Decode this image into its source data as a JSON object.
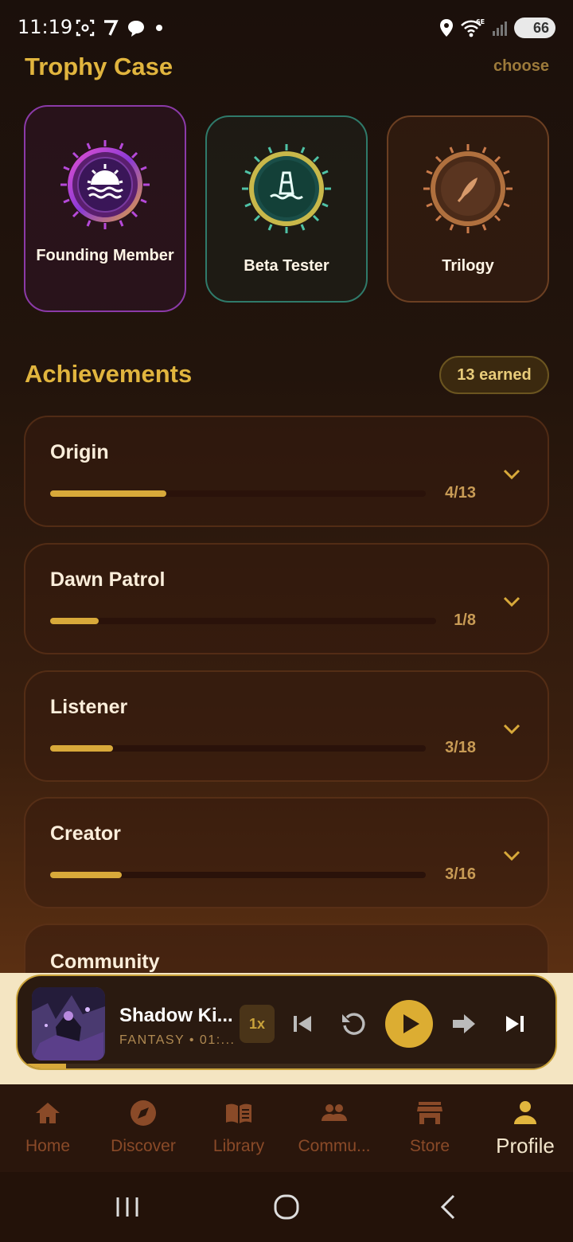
{
  "status_bar": {
    "time": "11:19",
    "battery": "66",
    "icons": [
      "screenshot-icon",
      "seven-icon",
      "chat-bubble-icon",
      "dot-icon",
      "location-icon",
      "wifi-6e-icon",
      "signal-icon",
      "battery-icon"
    ]
  },
  "trophy_case": {
    "title": "Trophy Case",
    "action": "choose",
    "items": [
      {
        "label": "Founding Member",
        "icon": "sunrise-icon",
        "color": "#b649d9"
      },
      {
        "label": "Beta Tester",
        "icon": "buoy-icon",
        "color": "#4fc2a6"
      },
      {
        "label": "Trilogy",
        "icon": "quill-icon",
        "color": "#c97b4a"
      }
    ]
  },
  "achievements": {
    "title": "Achievements",
    "earned": "13 earned",
    "items": [
      {
        "name": "Origin",
        "count": "4/13",
        "progress": 0.31
      },
      {
        "name": "Dawn Patrol",
        "count": "1/8",
        "progress": 0.125
      },
      {
        "name": "Listener",
        "count": "3/18",
        "progress": 0.167
      },
      {
        "name": "Creator",
        "count": "3/16",
        "progress": 0.19
      },
      {
        "name": "Community"
      }
    ]
  },
  "player": {
    "title": "Shadow Ki...",
    "subtitle": "FANTASY • 01:...",
    "speed": "1x",
    "progress": 0.09,
    "controls": [
      "skip-previous-icon",
      "replay-icon",
      "play-icon",
      "forward-arrow-icon",
      "skip-next-icon"
    ]
  },
  "nav": {
    "items": [
      {
        "label": "Home",
        "icon": "home-icon"
      },
      {
        "label": "Discover",
        "icon": "compass-icon"
      },
      {
        "label": "Library",
        "icon": "book-icon"
      },
      {
        "label": "Commu...",
        "icon": "people-icon"
      },
      {
        "label": "Store",
        "icon": "store-icon"
      },
      {
        "label": "Profile",
        "icon": "person-icon",
        "active": true
      }
    ]
  },
  "colors": {
    "accent": "#e1b53e",
    "background": "#22140c",
    "card": "#3a1f0e"
  }
}
